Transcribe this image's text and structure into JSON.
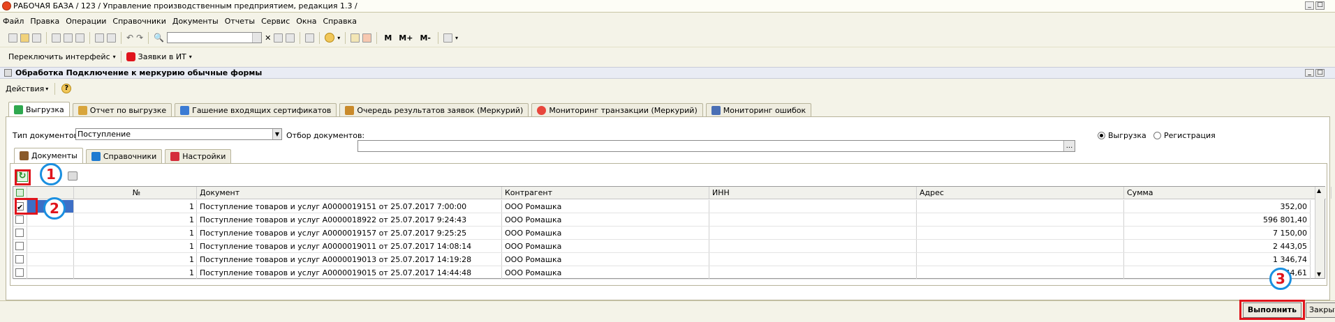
{
  "window": {
    "title": "РАБОЧАЯ БАЗА / 123 / Управление производственным предприятием, редакция 1.3 /"
  },
  "menu": [
    "Файл",
    "Правка",
    "Операции",
    "Справочники",
    "Документы",
    "Отчеты",
    "Сервис",
    "Окна",
    "Справка"
  ],
  "toolbar": {
    "items": [
      "М",
      "М+",
      "М-"
    ]
  },
  "toolbar2": {
    "switch_interface": "Переключить интерфейс",
    "requests": "Заявки в ИТ"
  },
  "form": {
    "title": "Обработка  Подключение к меркурию обычные формы",
    "actions": "Действия"
  },
  "top_tabs": [
    {
      "label": "Выгрузка",
      "color": "#2fa84f"
    },
    {
      "label": "Отчет по выгрузке",
      "color": "#d8a53c"
    },
    {
      "label": "Гашение входящих сертификатов",
      "color": "#3b7bd4"
    },
    {
      "label": "Очередь результатов заявок (Меркурий)",
      "color": "#c98a2b"
    },
    {
      "label": "Мониторинг транзакции (Меркурий)",
      "color": "#e8463c"
    },
    {
      "label": "Мониторинг ошибок",
      "color": "#4a6fb5"
    }
  ],
  "filters": {
    "doc_type_label": "Тип документов:",
    "doc_type_value": "Поступление",
    "doc_filter_label": "Отбор документов:",
    "doc_filter_value": "",
    "radio_export": "Выгрузка",
    "radio_reg": "Регистрация"
  },
  "inner_tabs": [
    "Документы",
    "Справочники",
    "Настройки"
  ],
  "table": {
    "headers": [
      "№",
      "Документ",
      "Контрагент",
      "ИНН",
      "Адрес",
      "Сумма"
    ],
    "rows": [
      {
        "checked": true,
        "n": "1",
        "doc": "Поступление товаров и услуг А0000019151 от 25.07.2017 7:00:00",
        "agent": "ООО Ромашка",
        "inn": "",
        "addr": "",
        "sum": "352,00"
      },
      {
        "checked": false,
        "n": "1",
        "doc": "Поступление товаров и услуг А0000018922 от 25.07.2017 9:24:43",
        "agent": "ООО Ромашка",
        "inn": "",
        "addr": "",
        "sum": "596 801,40"
      },
      {
        "checked": false,
        "n": "1",
        "doc": "Поступление товаров и услуг А0000019157 от 25.07.2017 9:25:25",
        "agent": "ООО Ромашка",
        "inn": "",
        "addr": "",
        "sum": "7 150,00"
      },
      {
        "checked": false,
        "n": "1",
        "doc": "Поступление товаров и услуг А0000019011 от 25.07.2017 14:08:14",
        "agent": "ООО Ромашка",
        "inn": "",
        "addr": "",
        "sum": "2 443,05"
      },
      {
        "checked": false,
        "n": "1",
        "doc": "Поступление товаров и услуг А0000019013 от 25.07.2017 14:19:28",
        "agent": "ООО Ромашка",
        "inn": "",
        "addr": "",
        "sum": "1 346,74"
      },
      {
        "checked": false,
        "n": "1",
        "doc": "Поступление товаров и услуг А0000019015 от 25.07.2017 14:44:48",
        "agent": "ООО Ромашка",
        "inn": "",
        "addr": "",
        "sum": "844,61"
      }
    ]
  },
  "annotations": [
    "1",
    "2",
    "3"
  ],
  "buttons": {
    "execute": "Выполнить",
    "close": "Закрыть"
  }
}
